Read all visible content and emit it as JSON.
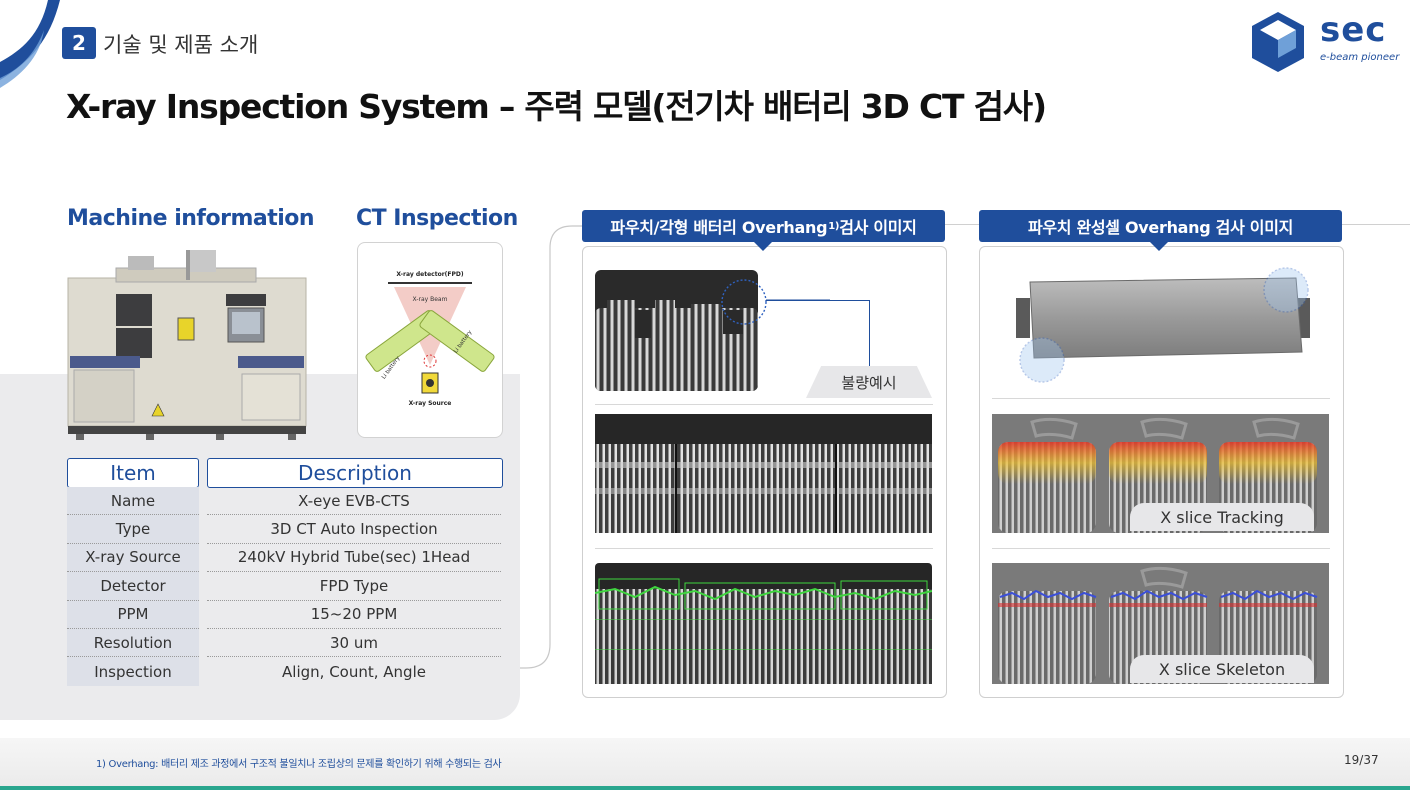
{
  "header": {
    "section_number": "2",
    "section_title": "기술 및 제품 소개",
    "main_title": "X-ray Inspection System – 주력 모델(전기차 배터리 3D CT 검사)"
  },
  "logo": {
    "word": "sec",
    "tagline": "e-beam pioneer",
    "color": "#1f4e9c"
  },
  "machine_info": {
    "heading": "Machine information"
  },
  "ct": {
    "heading": "CT Inspection",
    "detector_label": "X-ray detector(FPD)",
    "beam_label": "X-ray Beam",
    "battery_label": "Li battery",
    "source_label": "X-ray Source"
  },
  "spec_table": {
    "headers": {
      "item": "Item",
      "description": "Description"
    },
    "rows": [
      {
        "item": "Name",
        "description": "X-eye EVB-CTS"
      },
      {
        "item": "Type",
        "description": "3D CT Auto Inspection"
      },
      {
        "item": "X-ray Source",
        "description": "240kV Hybrid Tube(sec) 1Head"
      },
      {
        "item": "Detector",
        "description": "FPD Type"
      },
      {
        "item": "PPM",
        "description": "15~20 PPM"
      },
      {
        "item": "Resolution",
        "description": "30 um"
      },
      {
        "item": "Inspection",
        "description": "Align, Count, Angle"
      }
    ]
  },
  "left_panel": {
    "tag_text": "파우치/각형 배터리 Overhang",
    "tag_sup": "1)",
    "tag_suffix": " 검사 이미지",
    "defect_label": "불량예시"
  },
  "right_panel": {
    "tag_text": "파우치 완성셀 Overhang 검사 이미지",
    "tracking_label": "X slice Tracking",
    "skeleton_label": "X slice Skeleton"
  },
  "footer": {
    "footnote": "1) Overhang: 배터리 제조 과정에서 구조적 불일치나 조립상의 문제를 확인하기 위해 수행되는 검사",
    "page": "19/37"
  },
  "colors": {
    "primary": "#1f4e9c",
    "accent": "#2aa68e"
  }
}
